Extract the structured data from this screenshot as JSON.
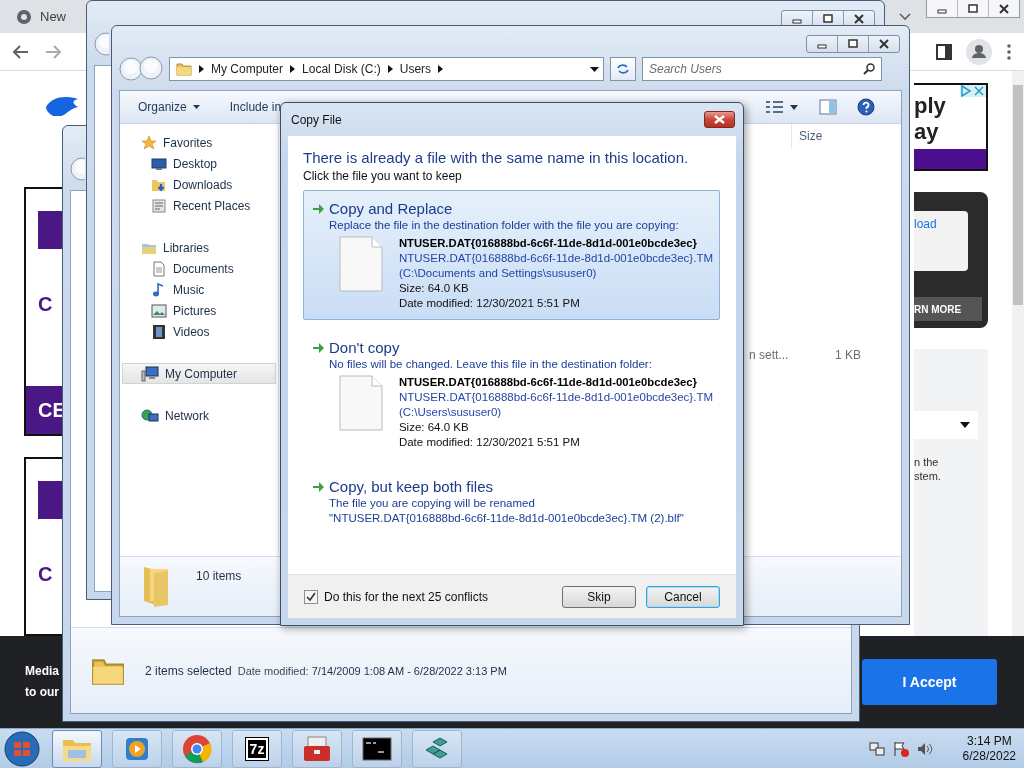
{
  "browser": {
    "tab": {
      "title": "New"
    },
    "left_cards": [
      {
        "text": "C",
        "banner": "CE"
      },
      {
        "text": "C"
      }
    ],
    "ad": {
      "lines": [
        "ply",
        "ay"
      ]
    },
    "promo_card": {
      "field_text": "load",
      "button": "RN MORE"
    },
    "side_panel": {
      "lines": [
        "n the",
        "stem."
      ]
    },
    "cookie_bar": {
      "lines": [
        "Media",
        "to our"
      ],
      "button": "I Accept"
    }
  },
  "explorer_back": {
    "status_bar": {
      "selection": "2 items selected",
      "date_label": "Date modified:",
      "date_value": "7/14/2009 1:08 AM - 6/28/2022 3:13 PM"
    }
  },
  "explorer": {
    "breadcrumb": [
      "My Computer",
      "Local Disk (C:)",
      "Users"
    ],
    "search": {
      "placeholder": "Search Users"
    },
    "toolbar": [
      {
        "label": "Organize",
        "kind": "menu"
      },
      {
        "label": "Include in",
        "kind": "button"
      }
    ],
    "nav_pane": [
      {
        "label": "Favorites",
        "kind": "favorites",
        "selected": false,
        "children": [
          {
            "label": "Desktop",
            "kind": "desktop",
            "selected": false
          },
          {
            "label": "Downloads",
            "kind": "downloads",
            "selected": false
          },
          {
            "label": "Recent Places",
            "kind": "recent",
            "selected": false
          }
        ]
      },
      {
        "label": "Libraries",
        "kind": "libraries",
        "selected": false,
        "children": [
          {
            "label": "Documents",
            "kind": "documents",
            "selected": false
          },
          {
            "label": "Music",
            "kind": "music",
            "selected": false
          },
          {
            "label": "Pictures",
            "kind": "pictures",
            "selected": false
          },
          {
            "label": "Videos",
            "kind": "videos",
            "selected": false
          }
        ]
      },
      {
        "label": "My Computer",
        "kind": "computer",
        "selected": true
      },
      {
        "label": "Network",
        "kind": "network",
        "selected": false
      }
    ],
    "columns": [
      "Size"
    ],
    "rows": [
      {
        "cells": [
          "n sett...",
          "1 KB"
        ]
      }
    ],
    "status_bar": {
      "count": "10 items"
    }
  },
  "dialog": {
    "title": "Copy File",
    "heading": "There is already a file with the same name in this location.",
    "instruction": "Click the file you want to keep",
    "options": [
      {
        "title": "Copy and Replace",
        "description": [
          "Replace the file in the destination folder with the file you are copying:"
        ],
        "selected": true,
        "file": {
          "name": "NTUSER.DAT{016888bd-6c6f-11de-8d1d-001e0bcde3ec}",
          "full_name": "NTUSER.DAT{016888bd-6c6f-11de-8d1d-001e0bcde3ec}.TM",
          "location": "(C:\\Documents and Settings\\sususer0)",
          "size": "Size: 64.0 KB",
          "date": "Date modified: 12/30/2021 5:51 PM"
        }
      },
      {
        "title": "Don't copy",
        "description": [
          "No files will be changed. Leave this file in the destination folder:"
        ],
        "selected": false,
        "file": {
          "name": "NTUSER.DAT{016888bd-6c6f-11de-8d1d-001e0bcde3ec}",
          "full_name": "NTUSER.DAT{016888bd-6c6f-11de-8d1d-001e0bcde3ec}.TM",
          "location": "(C:\\Users\\sususer0)",
          "size": "Size: 64.0 KB",
          "date": "Date modified: 12/30/2021 5:51 PM"
        }
      },
      {
        "title": "Copy, but keep both files",
        "description": [
          "The file you are copying will be renamed",
          "\"NTUSER.DAT{016888bd-6c6f-11de-8d1d-001e0bcde3ec}.TM (2).blf\""
        ],
        "selected": false
      }
    ],
    "footer": {
      "checkbox": {
        "label": "Do this for the next 25 conflicts",
        "checked": true
      },
      "buttons": [
        {
          "label": "Skip",
          "focused": false
        },
        {
          "label": "Cancel",
          "focused": true
        }
      ]
    }
  },
  "taskbar": {
    "apps": [
      {
        "kind": "explorer",
        "selected": true
      },
      {
        "kind": "media",
        "selected": false
      },
      {
        "kind": "chrome",
        "selected": false
      },
      {
        "kind": "archiver",
        "label": "7z",
        "selected": false
      },
      {
        "kind": "toolbox",
        "selected": false
      },
      {
        "kind": "console",
        "selected": false
      },
      {
        "kind": "cubes",
        "selected": false
      }
    ],
    "clock": {
      "time": "3:14 PM",
      "date": "6/28/2022"
    }
  }
}
